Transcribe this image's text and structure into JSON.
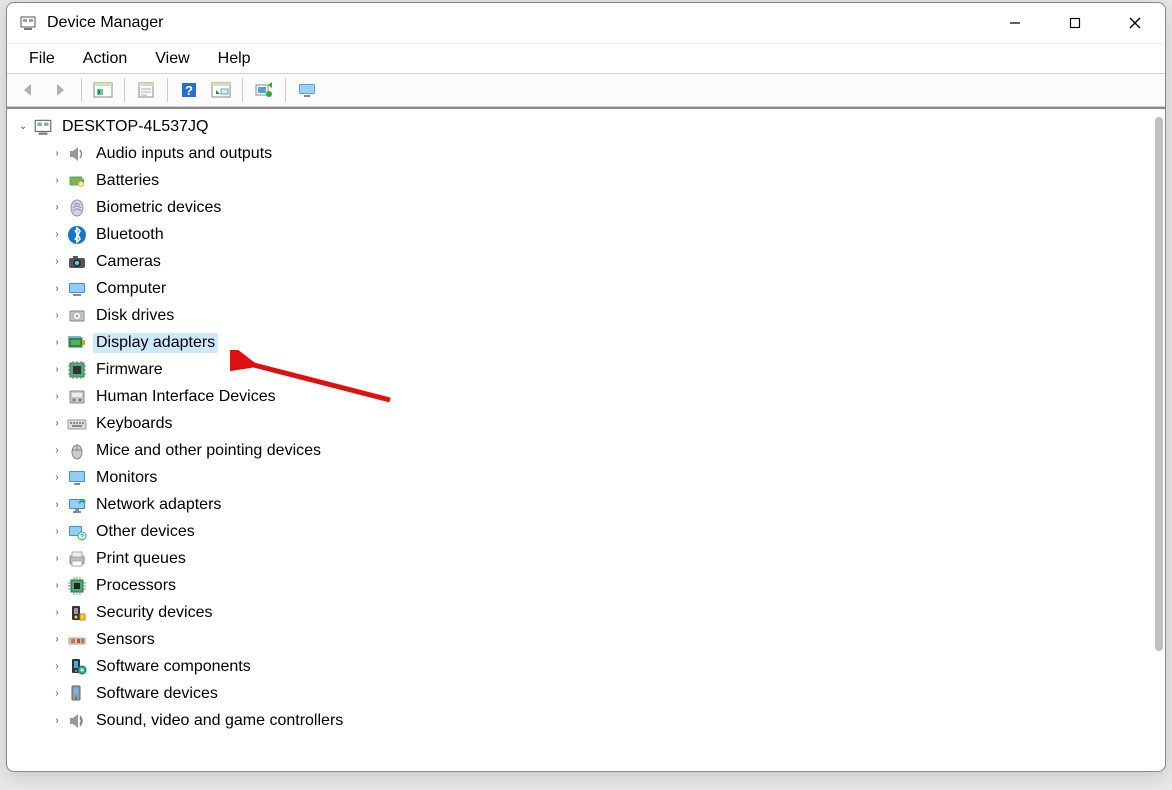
{
  "window": {
    "title": "Device Manager"
  },
  "menubar": {
    "items": [
      "File",
      "Action",
      "View",
      "Help"
    ]
  },
  "toolbar": {
    "buttons": [
      {
        "name": "back",
        "disabled": true
      },
      {
        "name": "forward",
        "disabled": true
      },
      {
        "name": "show-hidden"
      },
      {
        "name": "properties"
      },
      {
        "name": "help"
      },
      {
        "name": "show-tree"
      },
      {
        "name": "scan-hardware"
      },
      {
        "name": "monitor"
      }
    ]
  },
  "tree": {
    "root": {
      "label": "DESKTOP-4L537JQ",
      "expanded": true,
      "children": [
        {
          "label": "Audio inputs and outputs",
          "icon": "speaker"
        },
        {
          "label": "Batteries",
          "icon": "battery"
        },
        {
          "label": "Biometric devices",
          "icon": "fingerprint"
        },
        {
          "label": "Bluetooth",
          "icon": "bluetooth"
        },
        {
          "label": "Cameras",
          "icon": "camera"
        },
        {
          "label": "Computer",
          "icon": "computer"
        },
        {
          "label": "Disk drives",
          "icon": "disk"
        },
        {
          "label": "Display adapters",
          "icon": "display-adapter",
          "selected": true
        },
        {
          "label": "Firmware",
          "icon": "firmware"
        },
        {
          "label": "Human Interface Devices",
          "icon": "hid"
        },
        {
          "label": "Keyboards",
          "icon": "keyboard"
        },
        {
          "label": "Mice and other pointing devices",
          "icon": "mouse"
        },
        {
          "label": "Monitors",
          "icon": "monitor"
        },
        {
          "label": "Network adapters",
          "icon": "network"
        },
        {
          "label": "Other devices",
          "icon": "other"
        },
        {
          "label": "Print queues",
          "icon": "printer"
        },
        {
          "label": "Processors",
          "icon": "cpu"
        },
        {
          "label": "Security devices",
          "icon": "security"
        },
        {
          "label": "Sensors",
          "icon": "sensors"
        },
        {
          "label": "Software components",
          "icon": "software-comp"
        },
        {
          "label": "Software devices",
          "icon": "software-dev"
        },
        {
          "label": "Sound, video and game controllers",
          "icon": "sound"
        }
      ]
    }
  }
}
